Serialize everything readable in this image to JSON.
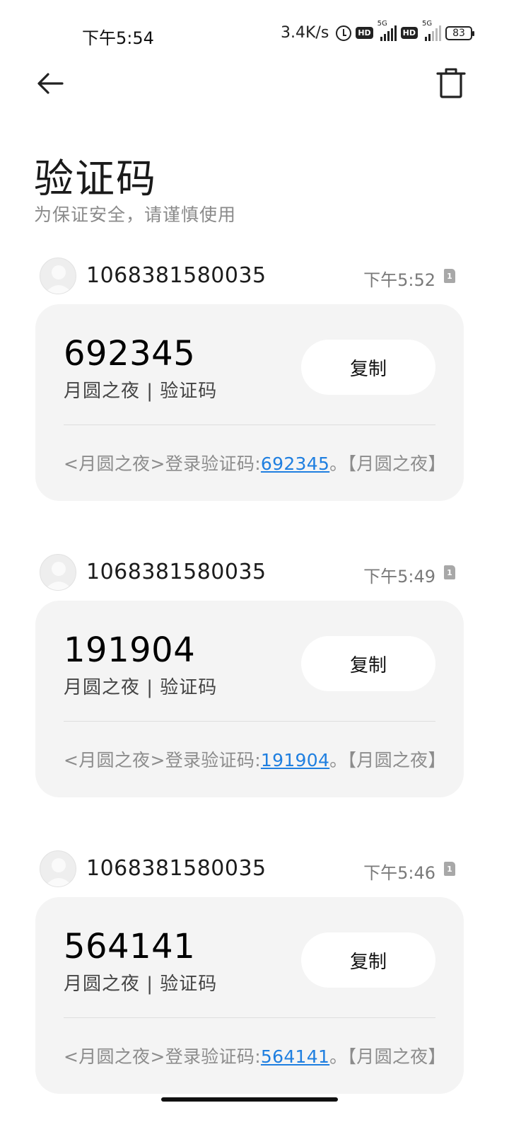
{
  "status_bar": {
    "time": "下午5:54",
    "net_speed": "3.4K/s",
    "hd_label": "HD",
    "sim1_network": "5G",
    "sim2_network": "5G",
    "battery": "83"
  },
  "header": {
    "title": "验证码",
    "subtitle": "为保证安全，请谨慎使用"
  },
  "messages": [
    {
      "sender": "1068381580035",
      "time": "下午5:52",
      "code": "692345",
      "source": "月圆之夜 | 验证码",
      "copy_label": "复制",
      "body_prefix": "<月圆之夜>登录验证码:",
      "body_code": "692345",
      "body_suffix": "。【月圆之夜】"
    },
    {
      "sender": "1068381580035",
      "time": "下午5:49",
      "code": "191904",
      "source": "月圆之夜 | 验证码",
      "copy_label": "复制",
      "body_prefix": "<月圆之夜>登录验证码:",
      "body_code": "191904",
      "body_suffix": "。【月圆之夜】"
    },
    {
      "sender": "1068381580035",
      "time": "下午5:46",
      "code": "564141",
      "source": "月圆之夜 | 验证码",
      "copy_label": "复制",
      "body_prefix": "<月圆之夜>登录验证码:",
      "body_code": "564141",
      "body_suffix": "。【月圆之夜】"
    }
  ],
  "colors": {
    "link": "#1f7fe0",
    "card_bg": "#f4f4f4",
    "subtitle": "#8a8a8a"
  }
}
